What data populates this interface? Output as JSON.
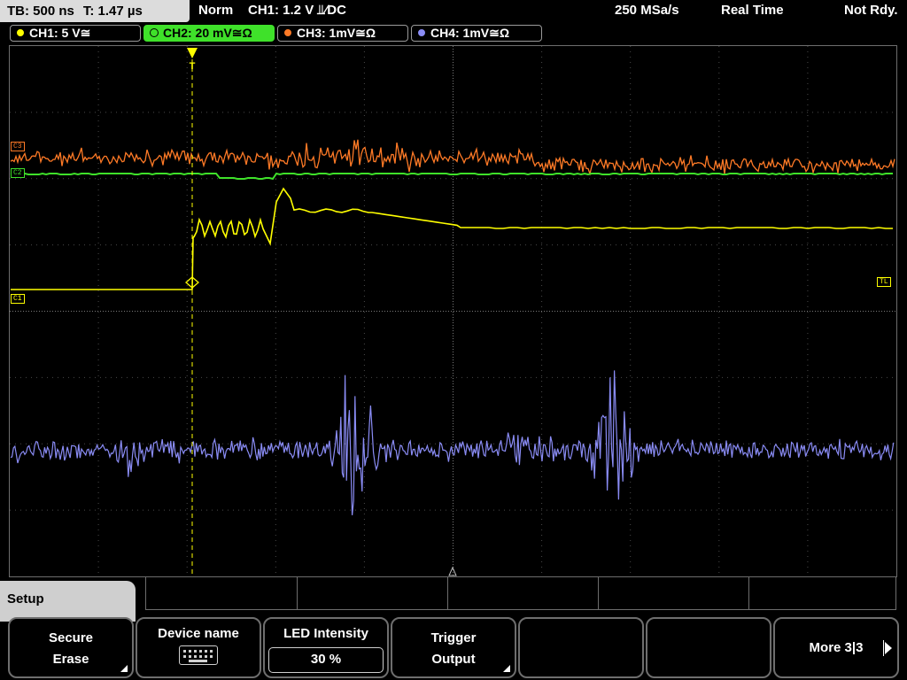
{
  "status": {
    "timebase": "TB: 500 ns",
    "trigger_time": "T: 1.47 µs",
    "mode": "Norm",
    "trigger": "CH1: 1.2 V ⫫∕DC",
    "sample_rate": "250 MSa/s",
    "acquisition": "Real Time",
    "state": "Not Rdy."
  },
  "channels": [
    {
      "label": "CH1: 5 V≅",
      "color": "#ffff00"
    },
    {
      "label": "CH2: 20 mV≅Ω",
      "color": "#3fe12a"
    },
    {
      "label": "CH3: 1mV≅Ω",
      "color": "#ff7a26"
    },
    {
      "label": "CH4: 1mV≅Ω",
      "color": "#8a8cf5"
    }
  ],
  "markers": {
    "c1": "C1",
    "c2": "C2",
    "c3": "C3",
    "tl": "TL",
    "trigger": "T"
  },
  "menu": {
    "tab": "Setup",
    "softkeys": [
      {
        "line1": "Secure",
        "line2": "Erase"
      },
      {
        "line1": "Device name",
        "icon": "keyboard-icon"
      },
      {
        "line1": "LED Intensity",
        "value": "30 %"
      },
      {
        "line1": "Trigger",
        "line2": "Output"
      },
      {
        "line1": ""
      },
      {
        "line1": ""
      },
      {
        "line1": "More 3|3"
      }
    ]
  },
  "colors": {
    "ch1": "#ffff00",
    "ch2": "#3fe12a",
    "ch3": "#ff7a26",
    "ch4": "#8a8cf5",
    "grid": "#5a5a5a"
  }
}
